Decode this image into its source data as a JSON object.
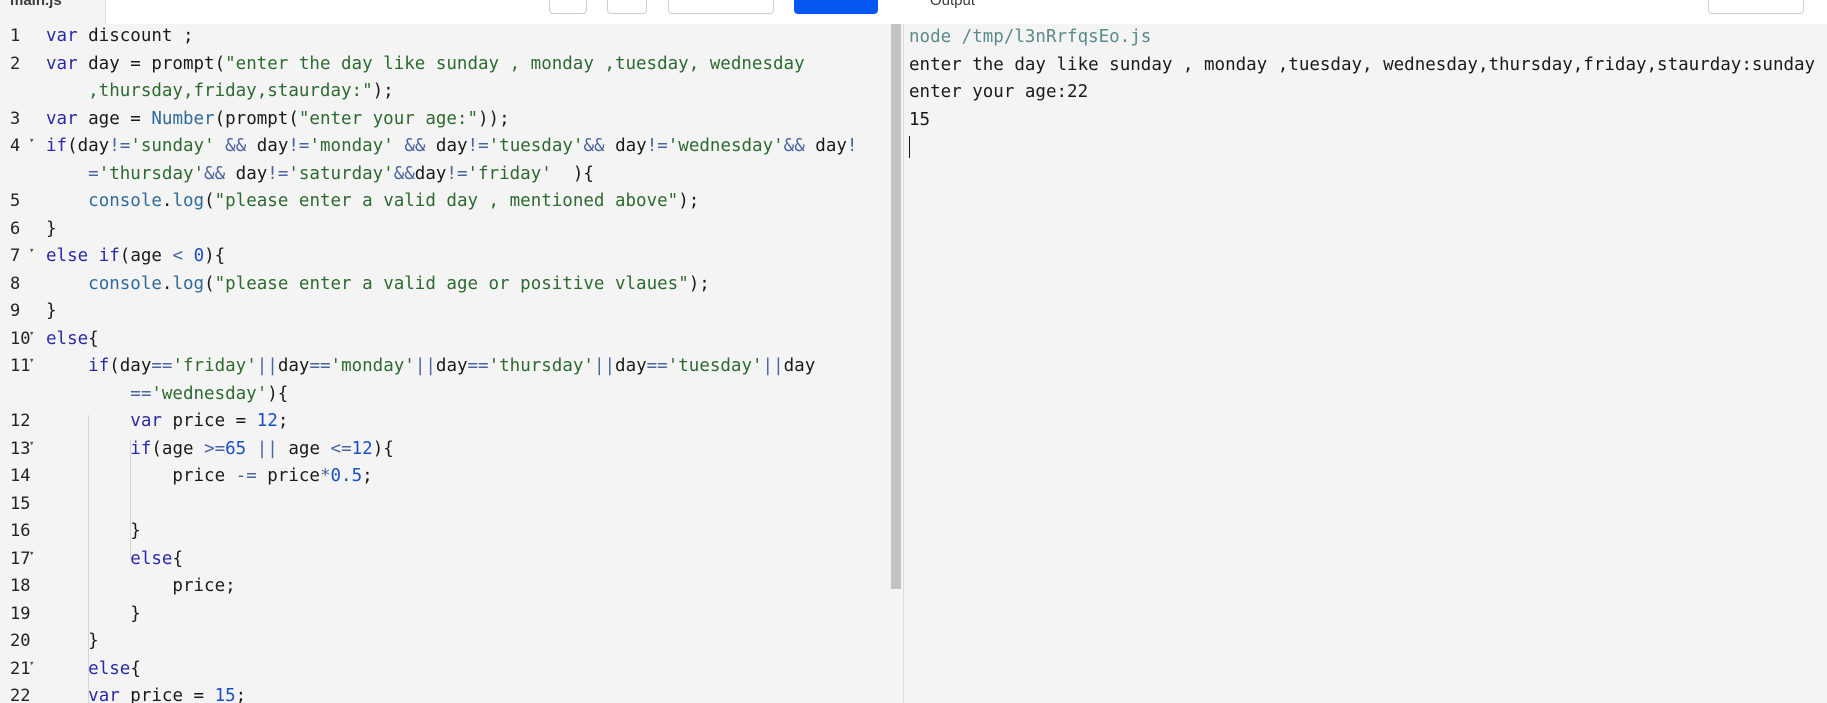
{
  "topbar": {
    "file_tab": "main.js",
    "output_tab": "Output"
  },
  "editor": {
    "lines": [
      {
        "n": "1",
        "fold": false
      },
      {
        "n": "2",
        "fold": false
      },
      {
        "n": "",
        "fold": false
      },
      {
        "n": "3",
        "fold": false
      },
      {
        "n": "4",
        "fold": true
      },
      {
        "n": "",
        "fold": false
      },
      {
        "n": "5",
        "fold": false
      },
      {
        "n": "6",
        "fold": false
      },
      {
        "n": "7",
        "fold": true
      },
      {
        "n": "8",
        "fold": false
      },
      {
        "n": "9",
        "fold": false
      },
      {
        "n": "10",
        "fold": true
      },
      {
        "n": "11",
        "fold": true
      },
      {
        "n": "",
        "fold": false
      },
      {
        "n": "12",
        "fold": false
      },
      {
        "n": "13",
        "fold": true
      },
      {
        "n": "14",
        "fold": false
      },
      {
        "n": "15",
        "fold": false
      },
      {
        "n": "16",
        "fold": false
      },
      {
        "n": "17",
        "fold": true
      },
      {
        "n": "18",
        "fold": false
      },
      {
        "n": "19",
        "fold": false
      },
      {
        "n": "20",
        "fold": false
      },
      {
        "n": "21",
        "fold": true
      },
      {
        "n": "22",
        "fold": false
      }
    ],
    "code": [
      [
        [
          "k",
          "var"
        ],
        [
          "t",
          " discount ;"
        ]
      ],
      [
        [
          "k",
          "var"
        ],
        [
          "t",
          " day = prompt("
        ],
        [
          "s",
          "\"enter the day like sunday , monday ,tuesday, wednesday"
        ]
      ],
      [
        [
          "s",
          "    ,thursday,friday,staurday:\""
        ],
        [
          "t",
          ");"
        ]
      ],
      [
        [
          "k",
          "var"
        ],
        [
          "t",
          " age = "
        ],
        [
          "b",
          "Number"
        ],
        [
          "t",
          "(prompt("
        ],
        [
          "s",
          "\"enter your age:\""
        ],
        [
          "t",
          "));"
        ]
      ],
      [
        [
          "k",
          "if"
        ],
        [
          "t",
          "(day"
        ],
        [
          "o",
          "!="
        ],
        [
          "s",
          "'sunday'"
        ],
        [
          "t",
          " "
        ],
        [
          "o",
          "&&"
        ],
        [
          "t",
          " day"
        ],
        [
          "o",
          "!="
        ],
        [
          "s",
          "'monday'"
        ],
        [
          "t",
          " "
        ],
        [
          "o",
          "&&"
        ],
        [
          "t",
          " day"
        ],
        [
          "o",
          "!="
        ],
        [
          "s",
          "'tuesday'"
        ],
        [
          "o",
          "&&"
        ],
        [
          "t",
          " day"
        ],
        [
          "o",
          "!="
        ],
        [
          "s",
          "'wednesday'"
        ],
        [
          "o",
          "&&"
        ],
        [
          "t",
          " day"
        ],
        [
          "o",
          "!"
        ]
      ],
      [
        [
          "o",
          "    ="
        ],
        [
          "s",
          "'thursday'"
        ],
        [
          "o",
          "&&"
        ],
        [
          "t",
          " day"
        ],
        [
          "o",
          "!="
        ],
        [
          "s",
          "'saturday'"
        ],
        [
          "o",
          "&&"
        ],
        [
          "t",
          "day"
        ],
        [
          "o",
          "!="
        ],
        [
          "s",
          "'friday'"
        ],
        [
          "t",
          "  ){"
        ]
      ],
      [
        [
          "t",
          "    "
        ],
        [
          "b",
          "console"
        ],
        [
          "t",
          "."
        ],
        [
          "b",
          "log"
        ],
        [
          "t",
          "("
        ],
        [
          "s",
          "\"please enter a valid day , mentioned above\""
        ],
        [
          "t",
          ");"
        ]
      ],
      [
        [
          "t",
          "}"
        ]
      ],
      [
        [
          "k",
          "else"
        ],
        [
          "t",
          " "
        ],
        [
          "k",
          "if"
        ],
        [
          "t",
          "(age "
        ],
        [
          "o",
          "<"
        ],
        [
          "t",
          " "
        ],
        [
          "n",
          "0"
        ],
        [
          "t",
          "){"
        ]
      ],
      [
        [
          "t",
          "    "
        ],
        [
          "b",
          "console"
        ],
        [
          "t",
          "."
        ],
        [
          "b",
          "log"
        ],
        [
          "t",
          "("
        ],
        [
          "s",
          "\"please enter a valid age or positive vlaues\""
        ],
        [
          "t",
          ");"
        ]
      ],
      [
        [
          "t",
          "}"
        ]
      ],
      [
        [
          "k",
          "else"
        ],
        [
          "t",
          "{"
        ]
      ],
      [
        [
          "t",
          "    "
        ],
        [
          "k",
          "if"
        ],
        [
          "t",
          "(day"
        ],
        [
          "o",
          "=="
        ],
        [
          "s",
          "'friday'"
        ],
        [
          "o",
          "||"
        ],
        [
          "t",
          "day"
        ],
        [
          "o",
          "=="
        ],
        [
          "s",
          "'monday'"
        ],
        [
          "o",
          "||"
        ],
        [
          "t",
          "day"
        ],
        [
          "o",
          "=="
        ],
        [
          "s",
          "'thursday'"
        ],
        [
          "o",
          "||"
        ],
        [
          "t",
          "day"
        ],
        [
          "o",
          "=="
        ],
        [
          "s",
          "'tuesday'"
        ],
        [
          "o",
          "||"
        ],
        [
          "t",
          "day"
        ]
      ],
      [
        [
          "o",
          "        =="
        ],
        [
          "s",
          "'wednesday'"
        ],
        [
          "t",
          "){"
        ]
      ],
      [
        [
          "t",
          "        "
        ],
        [
          "k",
          "var"
        ],
        [
          "t",
          " price = "
        ],
        [
          "n",
          "12"
        ],
        [
          "t",
          ";"
        ]
      ],
      [
        [
          "t",
          "        "
        ],
        [
          "k",
          "if"
        ],
        [
          "t",
          "(age "
        ],
        [
          "o",
          ">="
        ],
        [
          "n",
          "65"
        ],
        [
          "t",
          " "
        ],
        [
          "o",
          "||"
        ],
        [
          "t",
          " age "
        ],
        [
          "o",
          "<="
        ],
        [
          "n",
          "12"
        ],
        [
          "t",
          "){"
        ]
      ],
      [
        [
          "t",
          "            price "
        ],
        [
          "o",
          "-="
        ],
        [
          "t",
          " price"
        ],
        [
          "o",
          "*"
        ],
        [
          "n",
          "0.5"
        ],
        [
          "t",
          ";"
        ]
      ],
      [
        [
          "t",
          ""
        ]
      ],
      [
        [
          "t",
          "        }"
        ]
      ],
      [
        [
          "t",
          "        "
        ],
        [
          "k",
          "else"
        ],
        [
          "t",
          "{"
        ]
      ],
      [
        [
          "t",
          "            price;"
        ]
      ],
      [
        [
          "t",
          "        }"
        ]
      ],
      [
        [
          "t",
          "    }"
        ]
      ],
      [
        [
          "t",
          "    "
        ],
        [
          "k",
          "else"
        ],
        [
          "t",
          "{"
        ]
      ],
      [
        [
          "t",
          "    "
        ],
        [
          "k",
          "var"
        ],
        [
          "t",
          " price = "
        ],
        [
          "n",
          "15"
        ],
        [
          "t",
          ";"
        ]
      ]
    ]
  },
  "output": {
    "command": "node /tmp/l3nRrfqsEo.js",
    "lines": [
      "enter the day like sunday , monday ,tuesday, wednesday,thursday,friday,staurday:sunday",
      "enter your age:22",
      "15"
    ]
  },
  "colors": {
    "run_button": "#0556f3",
    "keyword": "#2a2aa8",
    "string": "#2d6a2f",
    "number": "#1a4ec6"
  }
}
